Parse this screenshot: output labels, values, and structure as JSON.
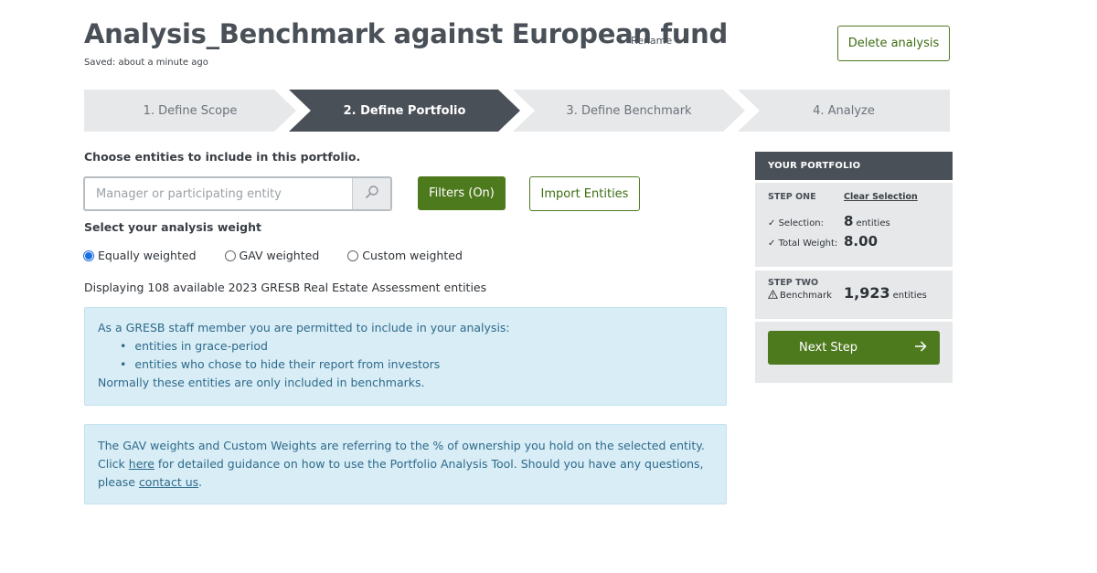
{
  "header": {
    "title": "Analysis_Benchmark against European fund",
    "rename_label": "Rename",
    "saved_text": "Saved: about a minute ago",
    "delete_label": "Delete analysis"
  },
  "steps": [
    {
      "label": "1. Define Scope",
      "active": false
    },
    {
      "label": "2. Define Portfolio",
      "active": true
    },
    {
      "label": "3. Define Benchmark",
      "active": false
    },
    {
      "label": "4. Analyze",
      "active": false
    }
  ],
  "main": {
    "choose_label": "Choose entities to include in this portfolio.",
    "search": {
      "placeholder": "Manager or participating entity",
      "value": ""
    },
    "filters_label": "Filters (On)",
    "import_label": "Import Entities",
    "weight_label": "Select your analysis weight",
    "weights": [
      {
        "label": "Equally weighted",
        "selected": true
      },
      {
        "label": "GAV weighted",
        "selected": false
      },
      {
        "label": "Custom weighted",
        "selected": false
      }
    ],
    "displaying": "Displaying 108 available 2023 GRESB Real Estate Assessment entities",
    "info1": {
      "intro": "As a GRESB staff member you are permitted to include in your analysis:",
      "bullets": [
        "entities in grace-period",
        "entities who chose to hide their report from investors"
      ],
      "outro": "Normally these entities are only included in benchmarks."
    },
    "info2": {
      "line1": "The GAV weights and Custom Weights are referring to the % of ownership you hold on the selected entity.",
      "click": "Click ",
      "here": "here",
      "rest": " for detailed guidance on how to use the Portfolio Analysis Tool. Should you have any questions,",
      "please": "please ",
      "contact": "contact us",
      "period": "."
    }
  },
  "portfolio": {
    "header": "YOUR PORTFOLIO",
    "step_one": "STEP ONE",
    "clear_label": "Clear Selection",
    "selection_label": "Selection:",
    "selection_value": "8",
    "selection_unit": "entities",
    "weight_label": "Total Weight:",
    "weight_value": "8.00",
    "step_two": "STEP TWO",
    "benchmark_label": "Benchmark",
    "benchmark_value": "1,923",
    "benchmark_unit": "entities",
    "next_label": "Next Step"
  },
  "icons": {
    "search": "search-icon",
    "check": "check-icon",
    "warning": "warning-icon",
    "arrow": "arrow-right-icon"
  },
  "colors": {
    "accent_green": "#4e7a1e",
    "dark_slate": "#4a5058",
    "info_bg": "#d8edf6",
    "info_text": "#2f6a8a"
  }
}
